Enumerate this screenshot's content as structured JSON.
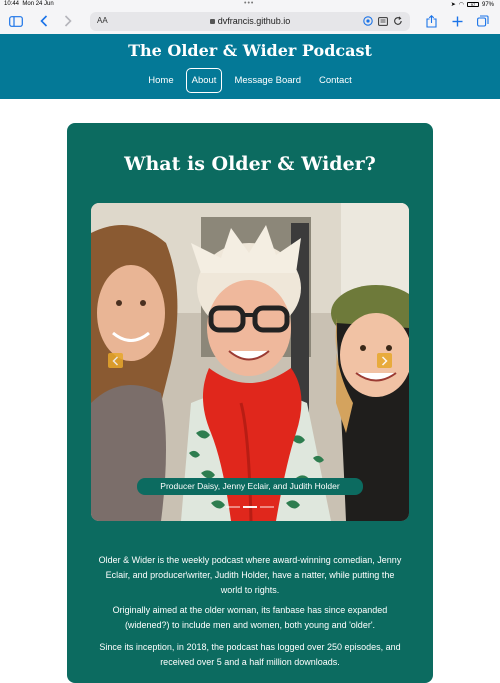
{
  "status_bar": {
    "time": "10:44",
    "date": "Mon 24 Jun",
    "battery_label": "97%",
    "battery_badge": "97"
  },
  "browser": {
    "text_size_label": "AA",
    "url": "dvfrancis.github.io",
    "accent_color": "#1a73e8"
  },
  "site": {
    "title": "The Older & Wider Podcast",
    "nav": [
      {
        "label": "Home"
      },
      {
        "label": "About",
        "active": true
      },
      {
        "label": "Message Board"
      },
      {
        "label": "Contact"
      }
    ],
    "header_color": "#047997"
  },
  "about": {
    "heading": "What is Older & Wider?",
    "carousel": {
      "caption": "Producer Daisy, Jenny Eclair, and Judith Holder",
      "slide_count": 3,
      "active_slide": 2
    },
    "paragraphs": [
      "Older & Wider is the weekly podcast where award-winning comedian, Jenny Eclair, and producer\\writer, Judith Holder, have a natter, while putting the world to rights.",
      "Originally aimed at the older woman, its fanbase has since expanded (widened?) to include men and women, both young and 'older'.",
      "Since its inception, in 2018, the podcast has logged over 250 episodes, and received over 5 and a half million downloads."
    ],
    "card_color": "#0c6b60"
  }
}
